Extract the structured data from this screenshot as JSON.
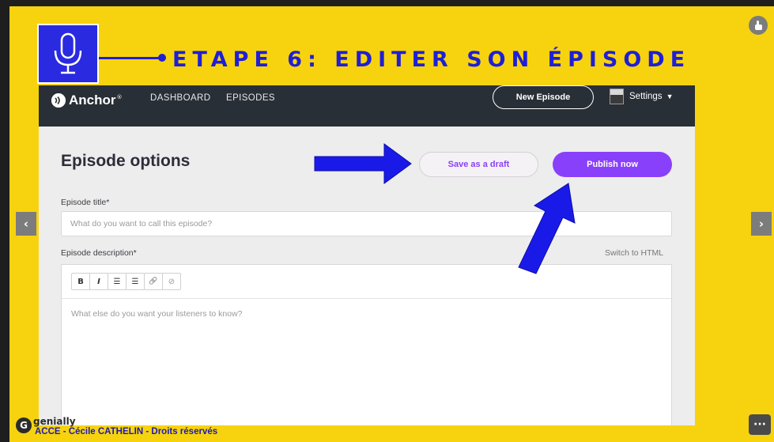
{
  "slide": {
    "title": "ETAPE 6: EDITER SON ÉPISODE",
    "footer_brand": "genially",
    "footer_credit": "ACCE - Cécile CATHELIN - Droits réservés",
    "icons": {
      "badge": "microphone-icon",
      "prev": "chevron-left-icon",
      "next": "chevron-right-icon",
      "hand": "hand-pointer-icon",
      "more": "more-dots-icon",
      "footer": "genially-logo-icon"
    },
    "colors": {
      "background": "#f7d30f",
      "accent_blue": "#1f1fd6",
      "anchor_purple": "#8940fa",
      "nav_dark": "#292f36"
    }
  },
  "app": {
    "logo_text": "Anchor",
    "logo_mark": "®",
    "nav": {
      "dashboard": "DASHBOARD",
      "episodes": "EPISODES",
      "new_episode": "New Episode",
      "settings": "Settings"
    },
    "heading": "Episode options",
    "draft_button": "Save as a draft",
    "publish_button": "Publish now",
    "title_label": "Episode title*",
    "title_placeholder": "What do you want to call this episode?",
    "description_label": "Episode description*",
    "switch_html": "Switch to HTML",
    "description_placeholder": "What else do you want your listeners to know?",
    "toolbar": {
      "bold": "B",
      "italic": "I",
      "bullet_list": "☰",
      "numbered_list": "☰",
      "link": "🔗",
      "unlink": "⊘"
    }
  }
}
